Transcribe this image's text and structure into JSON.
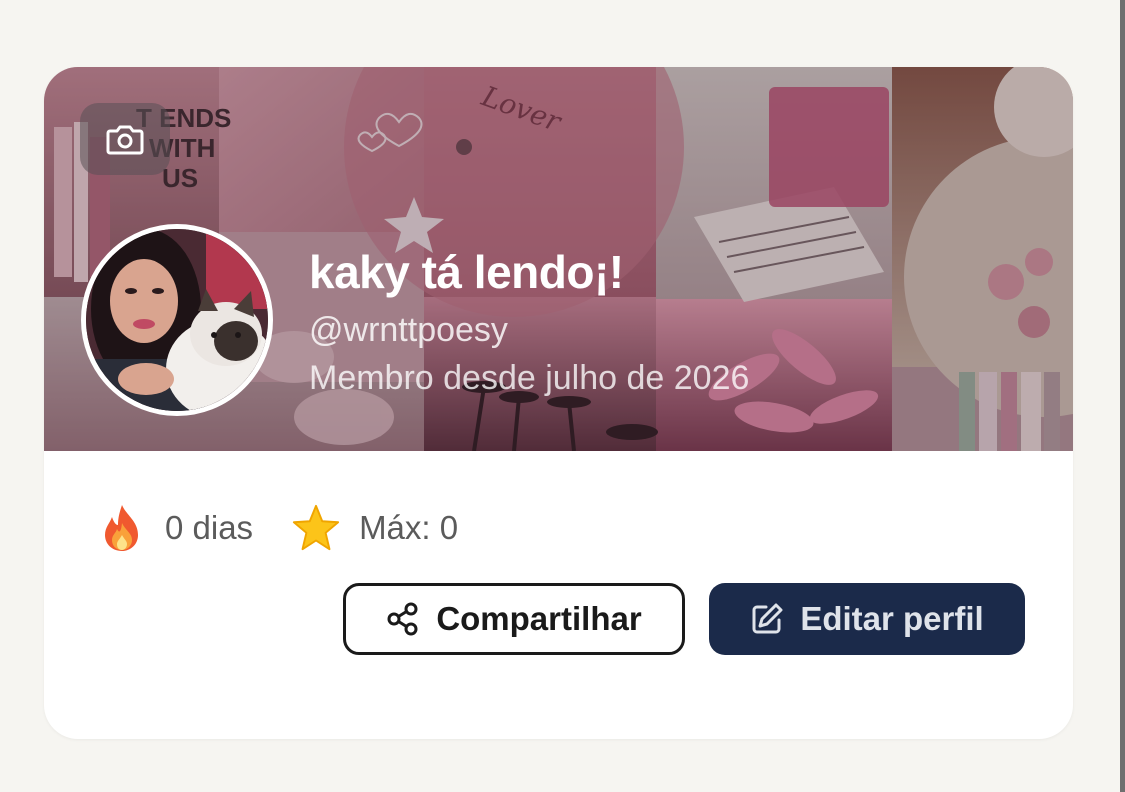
{
  "profile": {
    "display_name": "kaky tá lendo¡!",
    "handle": "@wrnttpoesy",
    "member_since": "Membro desde julho de 2026"
  },
  "cover": {
    "camera_icon": "camera-icon"
  },
  "stats": {
    "streak": {
      "icon": "fire-icon",
      "label": "0 dias"
    },
    "max": {
      "icon": "star-icon",
      "label": "Máx: 0"
    }
  },
  "actions": {
    "share_label": "Compartilhar",
    "share_icon": "share-icon",
    "edit_label": "Editar perfil",
    "edit_icon": "edit-icon"
  },
  "colors": {
    "edit_button_bg": "#1b2a4a",
    "share_button_border": "#1a1a1a",
    "page_bg": "#f6f5f1"
  }
}
